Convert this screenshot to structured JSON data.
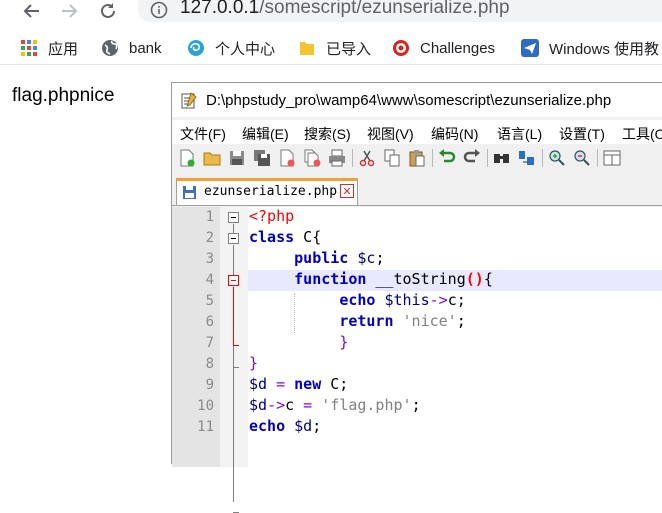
{
  "browser": {
    "url_host": "127.0.0.1",
    "url_path": "/somescript/ezunserialize.php",
    "bookmarks": [
      {
        "label": "应用",
        "icon": "apps-grid-icon"
      },
      {
        "label": "bank",
        "icon": "globe-icon"
      },
      {
        "label": "个人中心",
        "icon": "swirl-logo-icon"
      },
      {
        "label": "已导入",
        "icon": "folder-icon"
      },
      {
        "label": "Challenges",
        "icon": "target-logo-icon"
      },
      {
        "label": "Windows 使用教",
        "icon": "send-arrow-icon"
      }
    ]
  },
  "page": {
    "output_text": "flag.phpnice"
  },
  "editor": {
    "window_title": "D:\\phpstudy_pro\\wamp64\\www\\somescript\\ezunserialize.php",
    "menu": [
      "文件(F)",
      "编辑(E)",
      "搜索(S)",
      "视图(V)",
      "编码(N)",
      "语言(L)",
      "设置(T)",
      "工具(O"
    ],
    "tab_name": "ezunserialize.php",
    "tab_close": "✕",
    "line_numbers": [
      "1",
      "2",
      "3",
      "4",
      "5",
      "6",
      "7",
      "8",
      "9",
      "10",
      "11"
    ],
    "code": {
      "l1_tag": "<?php",
      "l2_kw": "class",
      "l2_rest": " C{",
      "l3_kw": "public",
      "l3_var": "$c",
      "l3_end": ";",
      "l4_kw": "function",
      "l4_name": " __toString",
      "l4_paren": "()",
      "l4_brace": "{",
      "l5_kw": "echo",
      "l5_var": "$this",
      "l5_op": "->",
      "l5_prop": "c",
      "l5_end": ";",
      "l6_kw": "return",
      "l6_str": "'nice'",
      "l6_end": ";",
      "l7": "}",
      "l8": "}",
      "l9_var": "$d",
      "l9_op": " = ",
      "l9_kw": "new",
      "l9_rest": " C;",
      "l10_var": "$d",
      "l10_op": "->",
      "l10_prop": "c",
      "l10_eq": " = ",
      "l10_str": "'flag.php'",
      "l10_end": ";",
      "l11_kw": "echo",
      "l11_var": "$d",
      "l11_end": ";"
    }
  },
  "colors": {
    "keyword": "#0000c8",
    "variable": "#000080",
    "string": "#808080",
    "php_tag": "#ff0000",
    "tab_accent": "#f6a033"
  }
}
